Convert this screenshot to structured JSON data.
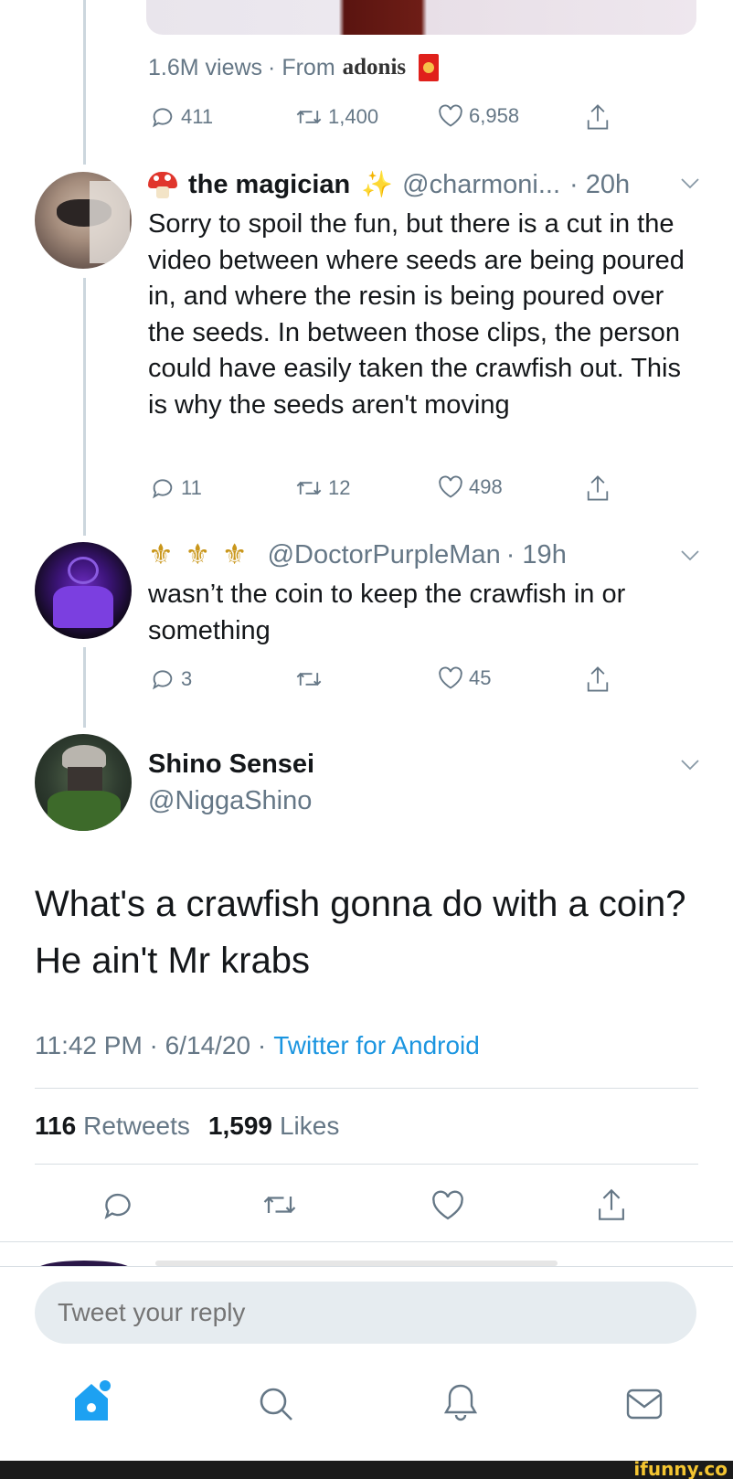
{
  "quoted": {
    "views": "1.6M views",
    "from_prefix": "· From",
    "from_name": "adonis",
    "replies": "411",
    "retweets": "1,400",
    "likes": "6,958"
  },
  "reply1": {
    "name": "the magician",
    "handle": "@charmoni...",
    "time": "· 20h",
    "text": "Sorry to spoil the fun, but there is a cut in the video between where seeds are being poured in, and where the resin is being poured over the seeds. In between those clips, the person could have easily taken the crawfish out. This is why the seeds aren't moving",
    "replies": "11",
    "retweets": "12",
    "likes": "498"
  },
  "reply2": {
    "name": "⚜ ⚜ ⚜",
    "handle": "@DoctorPurpleMan",
    "time": "· 19h",
    "text": "wasn’t the coin to keep the crawfish in or something",
    "replies": "3",
    "likes": "45"
  },
  "main": {
    "name": "Shino Sensei",
    "handle": "@NiggaShino",
    "text": "What's a crawfish gonna do with a coin? He ain't Mr krabs",
    "timestamp": "11:42 PM · 6/14/20 ·",
    "client": "Twitter for Android",
    "retweets_count": "116",
    "retweets_label": "Retweets",
    "likes_count": "1,599",
    "likes_label": "Likes"
  },
  "compose": {
    "placeholder": "Tweet your reply"
  },
  "watermark": "ifunny.co",
  "colors": {
    "accent": "#1da1f2",
    "secondary_text": "#657786",
    "divider": "#d8dee3",
    "thread_line": "#ccd6dd"
  },
  "icons": [
    "reply-icon",
    "retweet-icon",
    "like-icon",
    "share-icon",
    "chevron-down-icon",
    "home-icon",
    "search-icon",
    "notifications-icon",
    "messages-icon"
  ]
}
